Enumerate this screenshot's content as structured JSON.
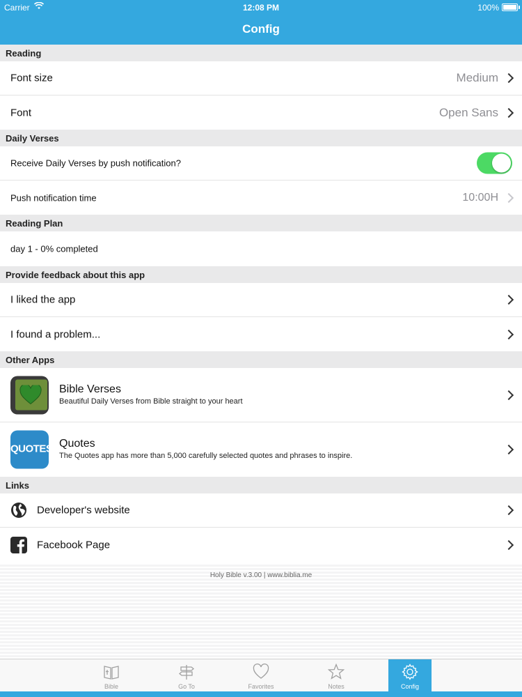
{
  "status_bar": {
    "carrier": "Carrier",
    "time": "12:08 PM",
    "battery": "100%"
  },
  "nav": {
    "title": "Config"
  },
  "sections": {
    "reading": "Reading",
    "daily_verses": "Daily Verses",
    "reading_plan": "Reading Plan",
    "feedback": "Provide feedback about this app",
    "other_apps": "Other Apps",
    "links": "Links"
  },
  "reading": {
    "font_size_label": "Font size",
    "font_size_value": "Medium",
    "font_label": "Font",
    "font_value": "Open Sans"
  },
  "daily": {
    "push_label": "Receive Daily Verses by push notification?",
    "push_enabled": true,
    "time_label": "Push notification time",
    "time_value": "10:00H"
  },
  "plan": {
    "progress_label": "day 1 - 0% completed"
  },
  "feedback": {
    "liked": "I liked the app",
    "problem": "I found a problem..."
  },
  "other_apps": [
    {
      "title": "Bible Verses",
      "subtitle": "Beautiful Daily Verses from Bible straight to your heart",
      "icon": "bible-verses-app-icon"
    },
    {
      "title": "Quotes",
      "subtitle": "The Quotes app has more than 5,000 carefully selected quotes and phrases to inspire.",
      "icon": "quotes-app-icon",
      "icon_text": "QUOTES"
    }
  ],
  "links": {
    "website": "Developer's website",
    "facebook": "Facebook Page"
  },
  "footer": {
    "text": "Holy Bible v.3.00 | www.biblia.me"
  },
  "tabs": [
    {
      "label": "Bible",
      "icon": "book-icon"
    },
    {
      "label": "Go To",
      "icon": "signpost-icon"
    },
    {
      "label": "Favorites",
      "icon": "heart-icon"
    },
    {
      "label": "Notes",
      "icon": "star-icon"
    },
    {
      "label": "Config",
      "icon": "gear-icon",
      "active": true
    }
  ],
  "colors": {
    "accent": "#34a8df",
    "toggle_on": "#4cd964",
    "section_bg": "#e9e9ea",
    "secondary_text": "#8e8e93"
  }
}
